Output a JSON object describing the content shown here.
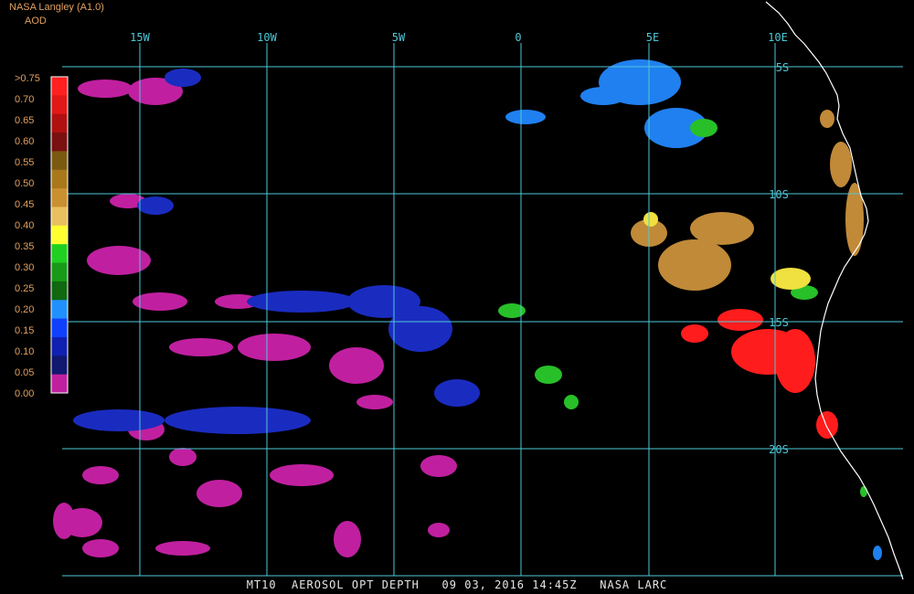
{
  "header": {
    "source": "NASA Langley (A1.0)",
    "product": "AOD"
  },
  "footer": {
    "caption": "MT10  AEROSOL OPT DEPTH   09 03, 2016 14:45Z   NASA LARC"
  },
  "colors": {
    "grid": "#4ec8d8",
    "coast": "#ffffff",
    "header_text": "#e0a060",
    "tick_label": "#4ec8d8"
  },
  "lon_labels": [
    "15W",
    "10W",
    "5W",
    "0",
    "5E",
    "10E"
  ],
  "lat_labels": [
    "5S",
    "10S",
    "15S",
    "20S"
  ],
  "legend": {
    "labels": [
      ">0.75",
      "0.70",
      "0.65",
      "0.60",
      "0.55",
      "0.50",
      "0.45",
      "0.40",
      "0.35",
      "0.30",
      "0.25",
      "0.20",
      "0.15",
      "0.10",
      "0.05",
      "0.00"
    ],
    "colors": [
      "#ff2020",
      "#e01818",
      "#b01010",
      "#7a1010",
      "#7a5a10",
      "#a8781a",
      "#c89030",
      "#e8c060",
      "#ffff30",
      "#20d020",
      "#189a18",
      "#106810",
      "#2090ff",
      "#1040ff",
      "#1020b0",
      "#101870",
      "#c020a0"
    ]
  }
}
